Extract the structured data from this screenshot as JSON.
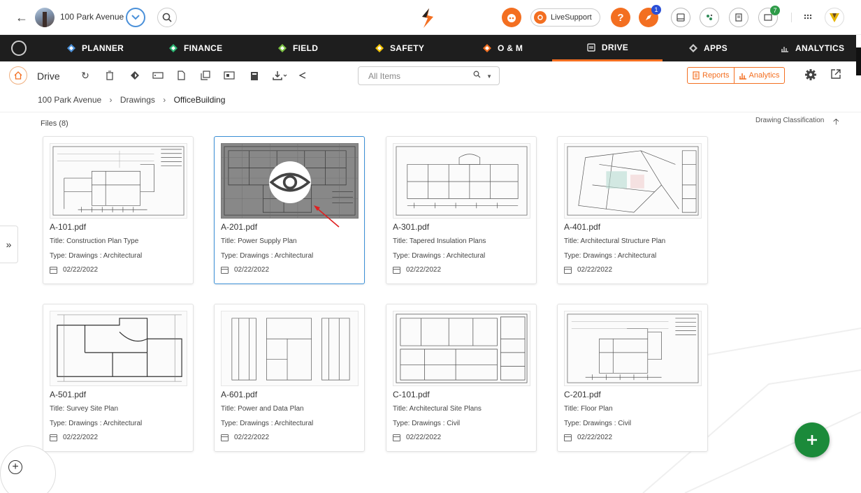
{
  "project": {
    "name": "100 Park Avenue"
  },
  "top_actions": {
    "live_support_label": "LiveSupport",
    "notification_count": "1",
    "cart_count": "7"
  },
  "nav": [
    {
      "label": "PLANNER",
      "icon": "planner-icon"
    },
    {
      "label": "FINANCE",
      "icon": "finance-icon"
    },
    {
      "label": "FIELD",
      "icon": "field-icon"
    },
    {
      "label": "SAFETY",
      "icon": "safety-icon"
    },
    {
      "label": "O & M",
      "icon": "om-icon"
    },
    {
      "label": "DRIVE",
      "icon": "drive-icon",
      "active": true
    },
    {
      "label": "APPS",
      "icon": "apps-icon"
    },
    {
      "label": "ANALYTICS",
      "icon": "analytics-icon"
    }
  ],
  "toolbar": {
    "title": "Drive",
    "search_placeholder": "All Items",
    "reports_label": "Reports",
    "analytics_label": "Analytics"
  },
  "breadcrumb": [
    "100 Park Avenue",
    "Drawings",
    "OfficeBuilding"
  ],
  "files_label": "Files (8)",
  "sort_label": "Drawing Classification",
  "files": [
    {
      "name": "A-101.pdf",
      "title": "Title: Construction Plan Type",
      "type": "Type: Drawings : Architectural",
      "date": "02/22/2022"
    },
    {
      "name": "A-201.pdf",
      "title": "Title: Power Supply Plan",
      "type": "Type: Drawings : Architectural",
      "date": "02/22/2022",
      "selected": true
    },
    {
      "name": "A-301.pdf",
      "title": "Title: Tapered Insulation Plans",
      "type": "Type: Drawings : Architectural",
      "date": "02/22/2022"
    },
    {
      "name": "A-401.pdf",
      "title": "Title: Architectural Structure Plan",
      "type": "Type: Drawings : Architectural",
      "date": "02/22/2022"
    },
    {
      "name": "A-501.pdf",
      "title": "Title: Survey Site Plan",
      "type": "Type: Drawings : Architectural",
      "date": "02/22/2022"
    },
    {
      "name": "A-601.pdf",
      "title": "Title: Power and Data Plan",
      "type": "Type: Drawings : Architectural",
      "date": "02/22/2022"
    },
    {
      "name": "C-101.pdf",
      "title": "Title: Architectural Site Plans",
      "type": "Type: Drawings : Civil",
      "date": "02/22/2022"
    },
    {
      "name": "C-201.pdf",
      "title": "Title: Floor Plan",
      "type": "Type: Drawings : Civil",
      "date": "02/22/2022"
    }
  ],
  "colors": {
    "accent": "#f36f21",
    "nav_bg": "#1e1e1e",
    "selected_border": "#3b8fd6",
    "fab": "#1b8a3a"
  }
}
